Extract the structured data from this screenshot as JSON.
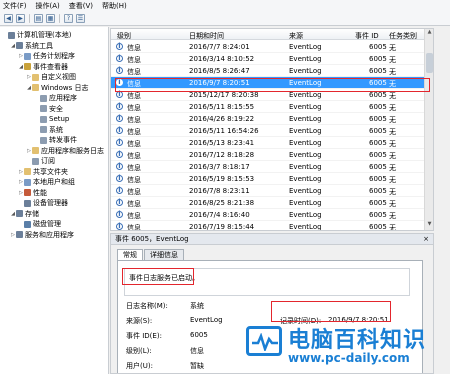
{
  "menu": [
    "文件(F)",
    "操作(A)",
    "查看(V)",
    "帮助(H)"
  ],
  "toolbar_icons": [
    "back-icon",
    "forward-icon",
    "folder-icon",
    "grid-icon",
    "help-icon",
    "list-icon"
  ],
  "tree": [
    {
      "label": "计算机管理(本地)",
      "indent": 0,
      "exp": "",
      "icon_color": "#6b7f99"
    },
    {
      "label": "系统工具",
      "indent": 1,
      "exp": "◢",
      "icon_color": "#6b7f99"
    },
    {
      "label": "任务计划程序",
      "indent": 2,
      "exp": "▷",
      "icon_color": "#7a9bc6"
    },
    {
      "label": "事件查看器",
      "indent": 2,
      "exp": "◢",
      "icon_color": "#c9a23a"
    },
    {
      "label": "自定义视图",
      "indent": 3,
      "exp": "▷",
      "icon_color": "#e2c070"
    },
    {
      "label": "Windows 日志",
      "indent": 3,
      "exp": "◢",
      "icon_color": "#e2c070"
    },
    {
      "label": "应用程序",
      "indent": 4,
      "exp": "",
      "icon_color": "#8c9cb0"
    },
    {
      "label": "安全",
      "indent": 4,
      "exp": "",
      "icon_color": "#8c9cb0"
    },
    {
      "label": "Setup",
      "indent": 4,
      "exp": "",
      "icon_color": "#8c9cb0"
    },
    {
      "label": "系统",
      "indent": 4,
      "exp": "",
      "icon_color": "#8c9cb0"
    },
    {
      "label": "转发事件",
      "indent": 4,
      "exp": "",
      "icon_color": "#8c9cb0"
    },
    {
      "label": "应用程序和服务日志",
      "indent": 3,
      "exp": "▷",
      "icon_color": "#e2c070"
    },
    {
      "label": "订阅",
      "indent": 3,
      "exp": "",
      "icon_color": "#8c9cb0"
    },
    {
      "label": "共享文件夹",
      "indent": 2,
      "exp": "▷",
      "icon_color": "#e2c070"
    },
    {
      "label": "本地用户和组",
      "indent": 2,
      "exp": "▷",
      "icon_color": "#7a9bc6"
    },
    {
      "label": "性能",
      "indent": 2,
      "exp": "▷",
      "icon_color": "#c55a3a"
    },
    {
      "label": "设备管理器",
      "indent": 2,
      "exp": "",
      "icon_color": "#6b7f99"
    },
    {
      "label": "存储",
      "indent": 1,
      "exp": "◢",
      "icon_color": "#6b7f99"
    },
    {
      "label": "磁盘管理",
      "indent": 2,
      "exp": "",
      "icon_color": "#5a7fa8"
    },
    {
      "label": "服务和应用程序",
      "indent": 1,
      "exp": "▷",
      "icon_color": "#6b7f99"
    }
  ],
  "grid": {
    "headers": {
      "level": "级别",
      "date": "日期和时间",
      "source": "来源",
      "event_id": "事件 ID",
      "task": "任务类别"
    },
    "rows": [
      {
        "level": "信息",
        "date": "2016/7/7 8:24:01",
        "source": "EventLog",
        "id": "6005",
        "task": "无"
      },
      {
        "level": "信息",
        "date": "2016/3/14 8:10:52",
        "source": "EventLog",
        "id": "6005",
        "task": "无"
      },
      {
        "level": "信息",
        "date": "2016/8/5 8:26:47",
        "source": "EventLog",
        "id": "6005",
        "task": "无"
      },
      {
        "level": "信息",
        "date": "2016/9/7 8:20:51",
        "source": "EventLog",
        "id": "6005",
        "task": "无"
      },
      {
        "level": "信息",
        "date": "2015/12/17 8:20:38",
        "source": "EventLog",
        "id": "6005",
        "task": "无"
      },
      {
        "level": "信息",
        "date": "2016/5/11 8:15:55",
        "source": "EventLog",
        "id": "6005",
        "task": "无"
      },
      {
        "level": "信息",
        "date": "2016/4/26 8:19:22",
        "source": "EventLog",
        "id": "6005",
        "task": "无"
      },
      {
        "level": "信息",
        "date": "2016/5/11 16:54:26",
        "source": "EventLog",
        "id": "6005",
        "task": "无"
      },
      {
        "level": "信息",
        "date": "2016/5/13 8:23:41",
        "source": "EventLog",
        "id": "6005",
        "task": "无"
      },
      {
        "level": "信息",
        "date": "2016/7/12 8:18:28",
        "source": "EventLog",
        "id": "6005",
        "task": "无"
      },
      {
        "level": "信息",
        "date": "2016/3/7 8:18:17",
        "source": "EventLog",
        "id": "6005",
        "task": "无"
      },
      {
        "level": "信息",
        "date": "2016/5/19 8:15:53",
        "source": "EventLog",
        "id": "6005",
        "task": "无"
      },
      {
        "level": "信息",
        "date": "2016/7/8 8:23:11",
        "source": "EventLog",
        "id": "6005",
        "task": "无"
      },
      {
        "level": "信息",
        "date": "2016/8/25 8:21:38",
        "source": "EventLog",
        "id": "6005",
        "task": "无"
      },
      {
        "level": "信息",
        "date": "2016/7/4 8:16:40",
        "source": "EventLog",
        "id": "6005",
        "task": "无"
      },
      {
        "level": "信息",
        "date": "2016/7/19 8:15:44",
        "source": "EventLog",
        "id": "6005",
        "task": "无"
      }
    ],
    "selected_index": 3
  },
  "detail": {
    "title": "事件 6005，EventLog",
    "close": "×",
    "tabs": [
      "常规",
      "详细信息"
    ],
    "message": "事件日志服务已启动。",
    "fields": {
      "log_name_label": "日志名称(M):",
      "log_name": "系统",
      "source_label": "来源(S):",
      "source": "EventLog",
      "recorded_label": "记录时间(D):",
      "recorded": "2016/9/7 8:20:51",
      "event_id_label": "事件 ID(E):",
      "event_id": "6005",
      "level_label": "级别(L):",
      "level": "信息",
      "user_label": "用户(U):",
      "user": "暂缺"
    }
  },
  "watermark": {
    "title": "电脑百科知识",
    "url": "www.pc-daily.com"
  }
}
